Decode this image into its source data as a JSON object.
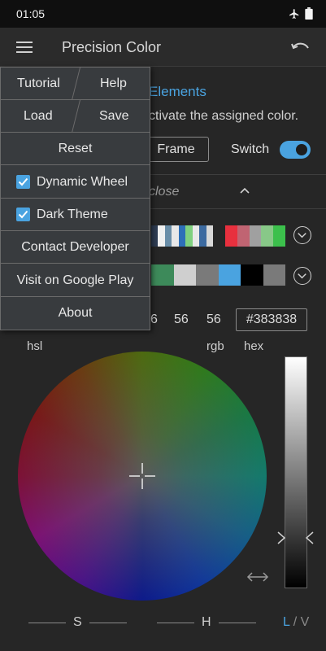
{
  "status_bar": {
    "time": "01:05"
  },
  "toolbar": {
    "title": "Precision Color"
  },
  "elements": {
    "title": "Elements",
    "description": "ctivate the assigned color.",
    "frame_label": "Frame",
    "switch_label": "Switch",
    "switch_on": true,
    "close_label": "close"
  },
  "swatches": {
    "row1a": [
      "#2e3c52",
      "#f0f0f0",
      "#6a8ea8",
      "#e8e8e8",
      "#2d6fb8",
      "#7fd07f",
      "#e8e8e8",
      "#3c6aa0",
      "#d8d8d8"
    ],
    "row1b": [
      "#e8303e",
      "#c06472",
      "#a0a0a0",
      "#88c888",
      "#3cc04c"
    ],
    "row2": [
      "#3d8a5a",
      "#cfcfcf",
      "#7a7a7a",
      "#4aa3e0",
      "#000000",
      "#7a7a7a"
    ]
  },
  "color": {
    "r": "6",
    "g": "56",
    "b": "56",
    "hex": "#383838",
    "hsl_label": "hsl",
    "rgb_label": "rgb",
    "hex_label": "hex"
  },
  "bottom": {
    "s_label": "S",
    "h_label": "H",
    "l_label": "L",
    "sep": "/",
    "v_label": "V"
  },
  "menu": {
    "tutorial": "Tutorial",
    "help": "Help",
    "load": "Load",
    "save": "Save",
    "reset": "Reset",
    "dynamic_wheel": "Dynamic Wheel",
    "dark_theme": "Dark Theme",
    "contact": "Contact Developer",
    "google_play": "Visit on Google Play",
    "about": "About"
  },
  "colors": {
    "accent": "#4aa3e0",
    "background": "#262626"
  }
}
